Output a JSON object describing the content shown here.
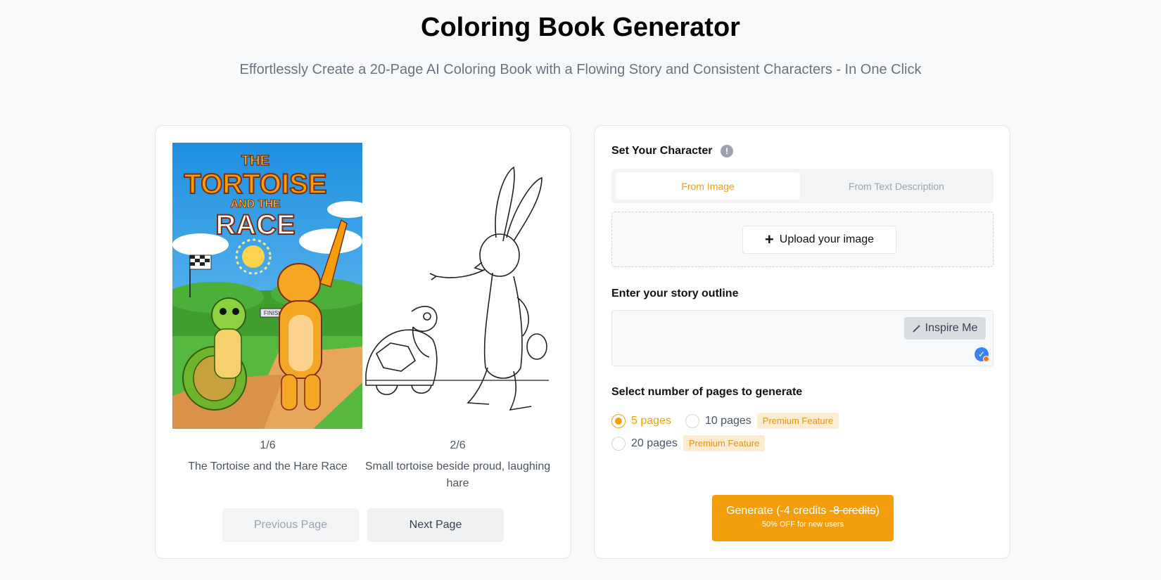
{
  "header": {
    "title": "Coloring Book Generator",
    "subtitle": "Effortlessly Create a 20-Page AI Coloring Book with a Flowing Story and Consistent Characters - In One Click"
  },
  "preview": {
    "pages": [
      {
        "number": "1/6",
        "caption": "The Tortoise and the Hare Race",
        "cover_title_line1": "THE",
        "cover_title_line2": "TORTOISE",
        "cover_title_line3": "AND THE",
        "cover_title_line4": "RACE",
        "sign_finish": "FINISH"
      },
      {
        "number": "2/6",
        "caption": "Small tortoise beside proud, laughing hare"
      }
    ],
    "prev_label": "Previous Page",
    "next_label": "Next Page"
  },
  "form": {
    "character_label": "Set Your Character",
    "info_icon": "!",
    "tabs": [
      {
        "label": "From Image",
        "active": true
      },
      {
        "label": "From Text Description",
        "active": false
      }
    ],
    "upload_label": "Upload your image",
    "story_label": "Enter your story outline",
    "story_value": "",
    "inspire_label": "Inspire Me",
    "pages_label": "Select number of pages to generate",
    "page_options": [
      {
        "label": "5 pages",
        "selected": true
      },
      {
        "label": "10 pages",
        "selected": false,
        "badge": "Premium Feature"
      },
      {
        "label": "20 pages",
        "selected": false,
        "badge": "Premium Feature"
      }
    ],
    "generate": {
      "prefix": "Generate (",
      "credits": "-4 credits",
      "old_credits": "-8 credits",
      "suffix": ")",
      "sub": "50% OFF for new users"
    }
  },
  "colors": {
    "accent": "#f59e0b",
    "premium_bg": "#feecd0",
    "muted_text": "#6b7280"
  }
}
